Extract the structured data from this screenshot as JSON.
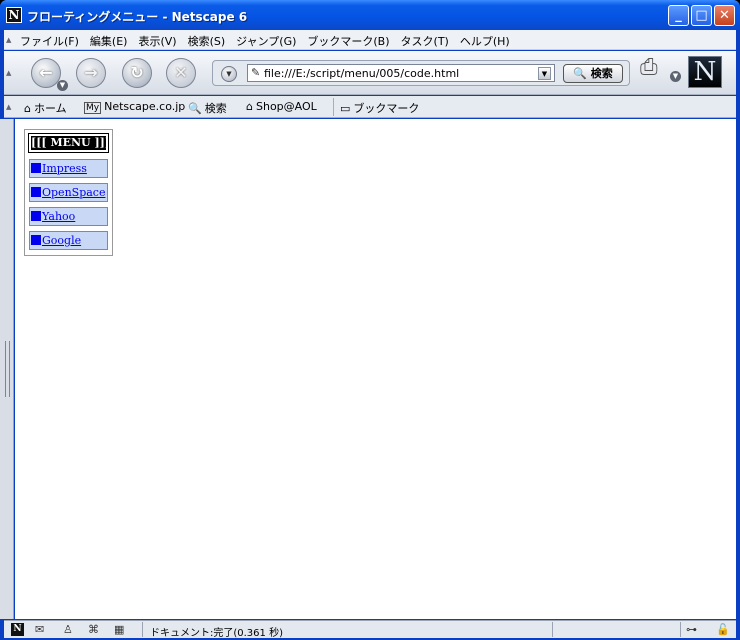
{
  "window": {
    "title": "フローティングメニュー - Netscape 6",
    "app_icon": "N",
    "minimize": "_",
    "maximize": "□",
    "close": "✕"
  },
  "menubar": {
    "items": [
      "ファイル(F)",
      "編集(E)",
      "表示(V)",
      "検索(S)",
      "ジャンプ(G)",
      "ブックマーク(B)",
      "タスク(T)",
      "ヘルプ(H)"
    ]
  },
  "navbar": {
    "url": "file:///E:/script/menu/005/code.html",
    "search_label": "検索",
    "logo": "N"
  },
  "personal_toolbar": {
    "home": "ホーム",
    "my_badge": "My",
    "netscape": "Netscape.co.jp",
    "search": "検索",
    "shop": "Shop@AOL",
    "bookmarks": "ブックマーク"
  },
  "floating_menu": {
    "title": "[[[ MENU ]]]",
    "items": [
      {
        "label": "Impress"
      },
      {
        "label": "OpenSpace"
      },
      {
        "label": "Yahoo"
      },
      {
        "label": "Google"
      }
    ]
  },
  "statusbar": {
    "text": "ドキュメント:完了(0.361 秒)"
  }
}
